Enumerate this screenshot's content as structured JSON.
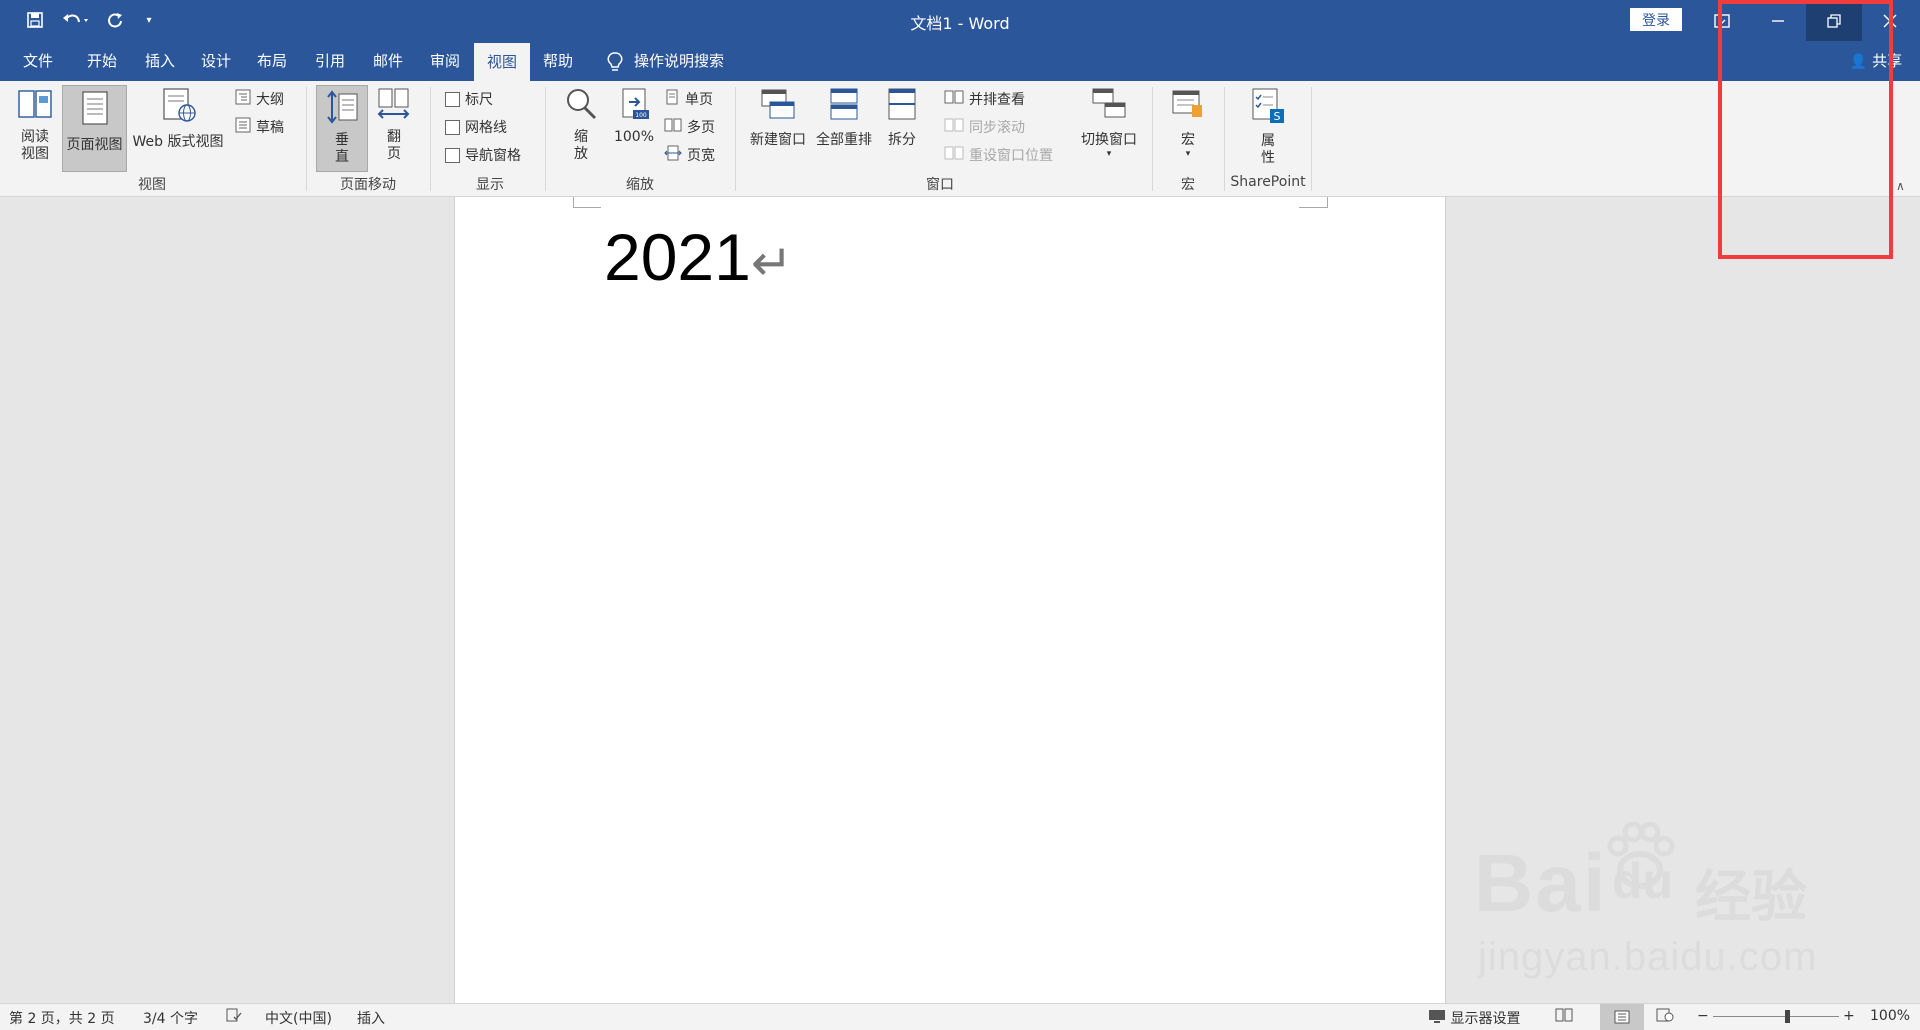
{
  "window": {
    "title": "文档1  -  Word",
    "login_label": "登录",
    "share_label": "共享",
    "controls": [
      "ribbon-display-options",
      "minimize",
      "restore",
      "close"
    ]
  },
  "quick_access": {
    "icons": [
      "save-icon",
      "undo-icon",
      "redo-icon",
      "customize-icon"
    ]
  },
  "tabs": [
    {
      "label": "文件",
      "active": false
    },
    {
      "label": "开始",
      "active": false
    },
    {
      "label": "插入",
      "active": false
    },
    {
      "label": "设计",
      "active": false
    },
    {
      "label": "布局",
      "active": false
    },
    {
      "label": "引用",
      "active": false
    },
    {
      "label": "邮件",
      "active": false
    },
    {
      "label": "审阅",
      "active": false
    },
    {
      "label": "视图",
      "active": true
    },
    {
      "label": "帮助",
      "active": false
    }
  ],
  "tell_me": "操作说明搜索",
  "ribbon": {
    "views": {
      "label": "视图",
      "read_mode": "阅读\n视图",
      "print_layout": "页面视图",
      "web_layout": "Web 版式视图",
      "outline": "大纲",
      "draft": "草稿"
    },
    "page_movement": {
      "label": "页面移动",
      "vertical": "垂\n直",
      "side_to_side": "翻\n页"
    },
    "show": {
      "label": "显示",
      "ruler": "标尺",
      "gridlines": "网格线",
      "nav_pane": "导航窗格"
    },
    "zoom": {
      "label": "缩放",
      "zoom": "缩\n放",
      "hundred": "100%",
      "one_page": "单页",
      "multiple_pages": "多页",
      "page_width": "页宽"
    },
    "window": {
      "label": "窗口",
      "new_window": "新建窗口",
      "arrange_all": "全部重排",
      "split": "拆分",
      "side_by_side": "并排查看",
      "sync_scroll": "同步滚动",
      "reset_position": "重设窗口位置",
      "switch_windows": "切换窗口"
    },
    "macros": {
      "label": "宏",
      "macros": "宏"
    },
    "sharepoint": {
      "label": "SharePoint",
      "properties": "属\n性"
    }
  },
  "document": {
    "text": "2021",
    "paragraph_mark": "↵"
  },
  "status": {
    "page": "第 2 页，共 2 页",
    "words": "3/4 个字",
    "language": "中文(中国)",
    "mode": "插入",
    "display_settings": "显示器设置",
    "zoom": "100%",
    "zoom_level": 1.0
  },
  "watermark": {
    "brand": "Bai",
    "brand2": "du",
    "jingyan": "经验",
    "url": "jingyan.baidu.com"
  },
  "accent": "#2b579a",
  "highlight_color": "#f03c3c"
}
